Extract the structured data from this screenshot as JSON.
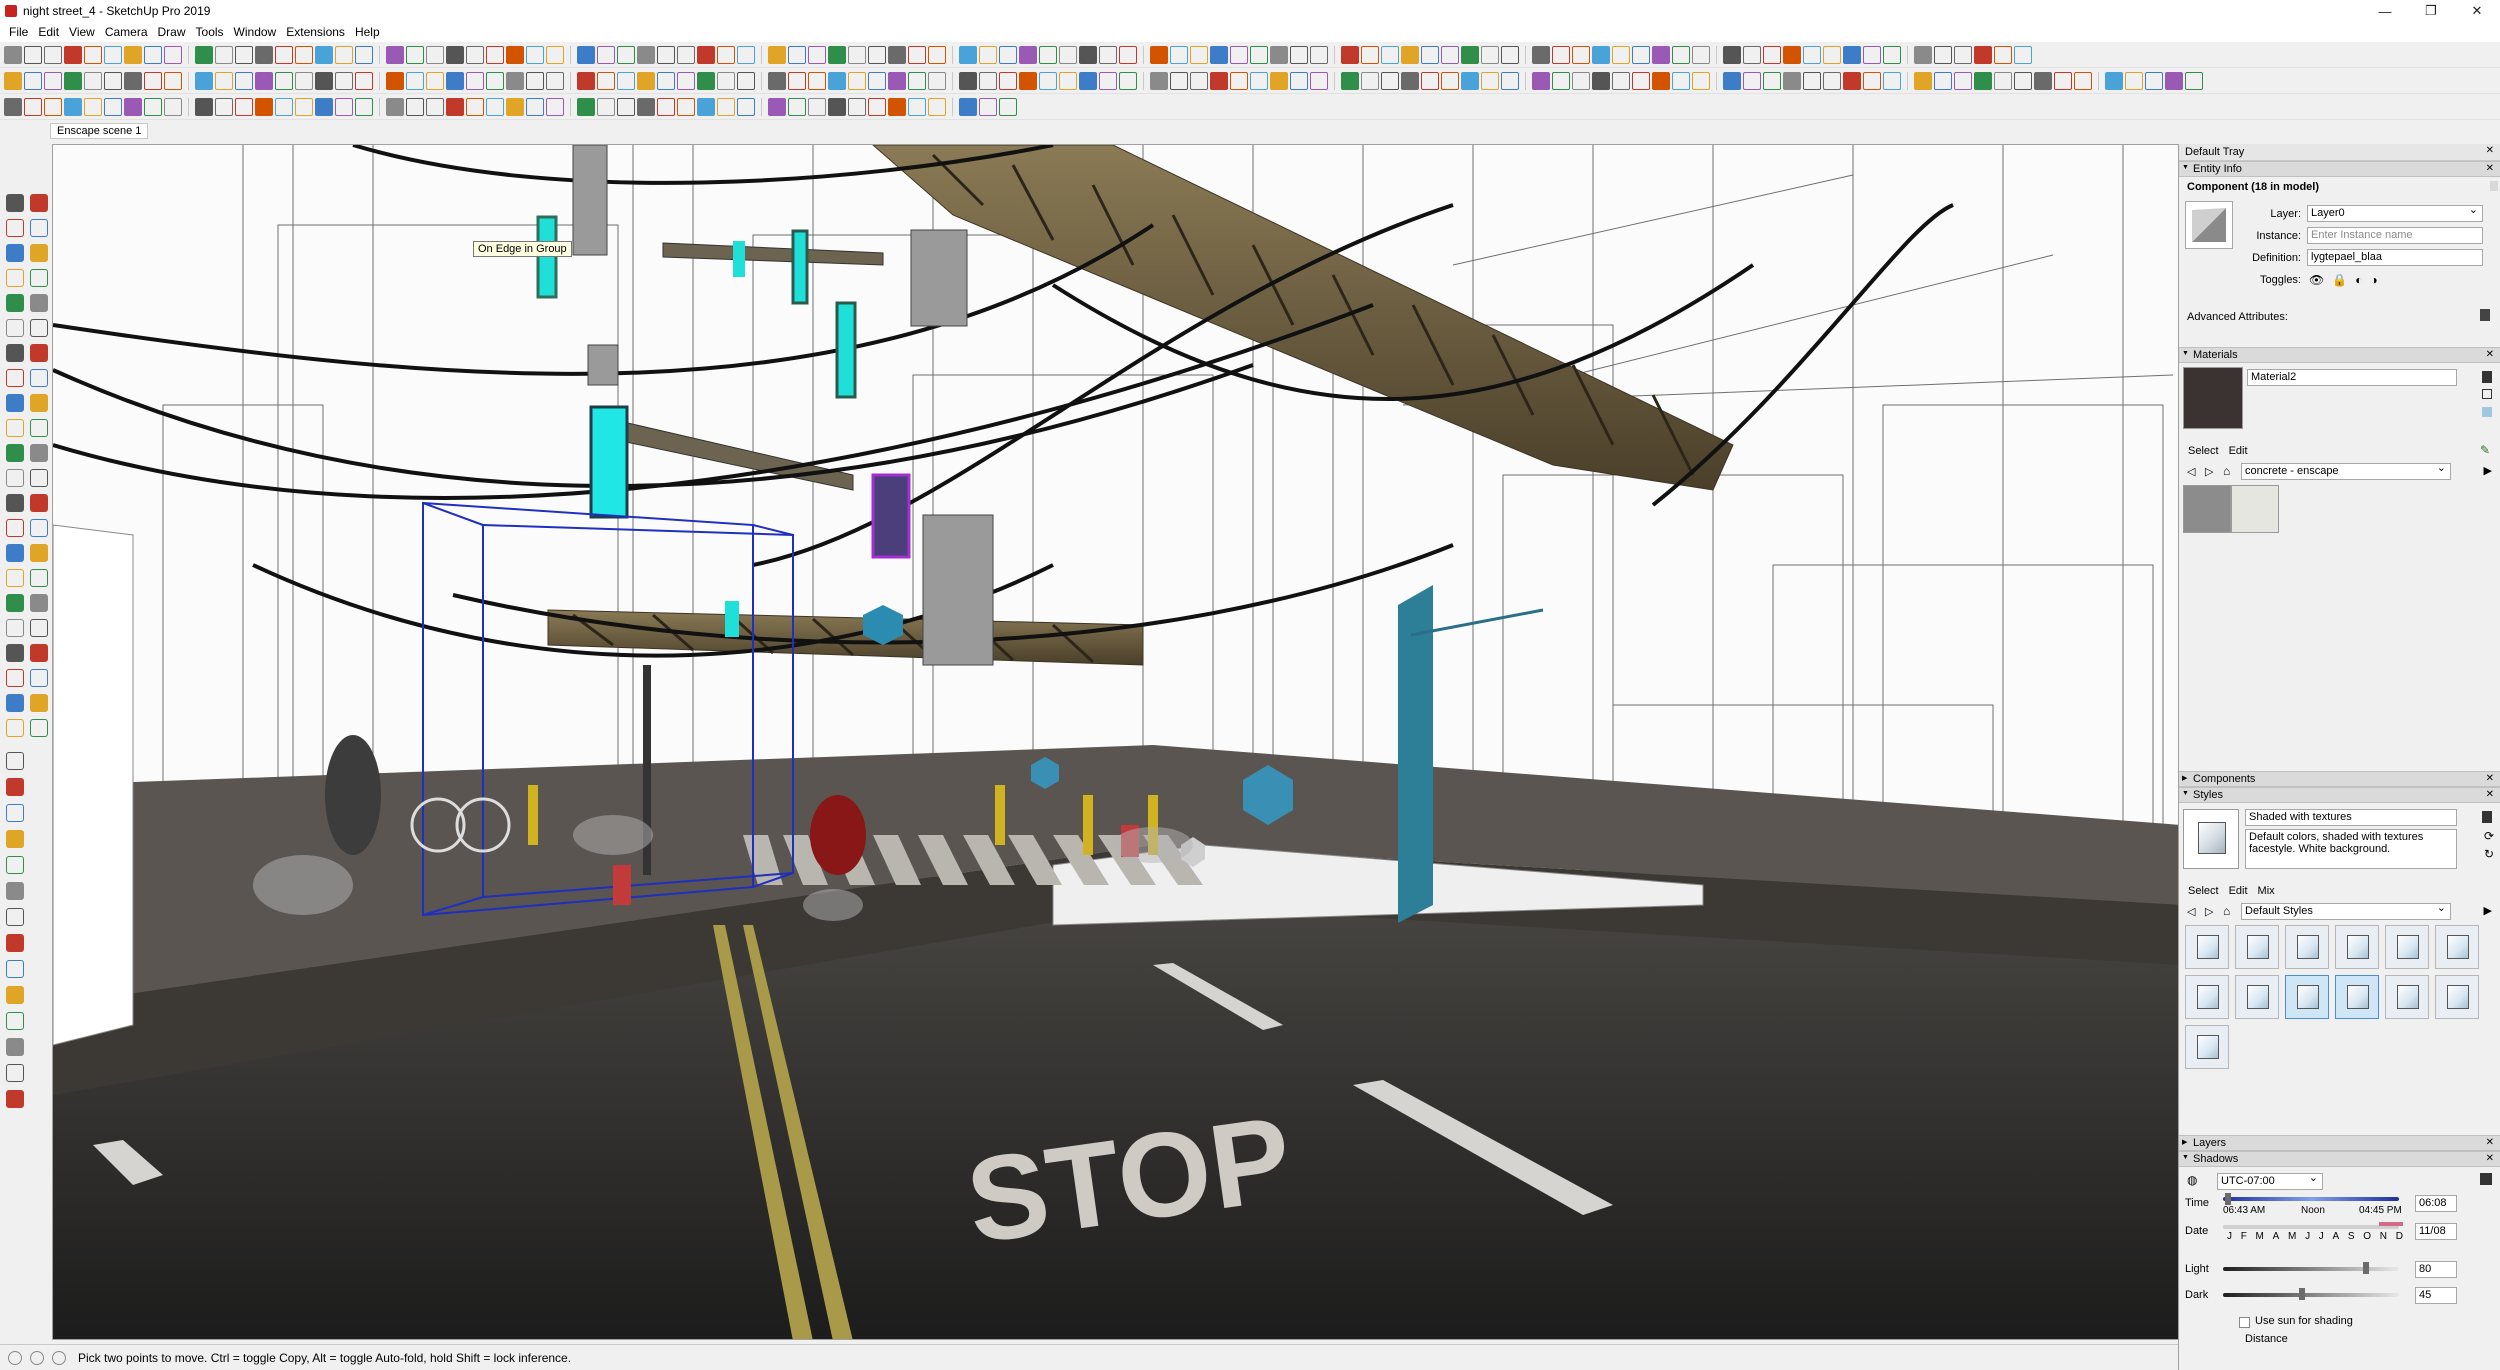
{
  "window": {
    "title": "night street_4 - SketchUp Pro 2019",
    "controls": [
      "—",
      "❐",
      "✕"
    ]
  },
  "menu": [
    "File",
    "Edit",
    "View",
    "Camera",
    "Draw",
    "Tools",
    "Window",
    "Extensions",
    "Help"
  ],
  "scene_tab": "Enscape scene 1",
  "viewport": {
    "tooltip": "On Edge in Group",
    "ground_text": "STOP"
  },
  "status_bar": {
    "hint": "Pick two points to move.  Ctrl = toggle Copy, Alt = toggle Auto-fold, hold Shift = lock inference."
  },
  "tray": {
    "title": "Default Tray",
    "entity_info": {
      "header": "Entity Info",
      "component_title": "Component (18 in model)",
      "layer_label": "Layer:",
      "layer_value": "Layer0",
      "instance_label": "Instance:",
      "instance_placeholder": "Enter Instance name",
      "definition_label": "Definition:",
      "definition_value": "lygtepael_blaa",
      "toggles_label": "Toggles:",
      "advanced": "Advanced Attributes:"
    },
    "materials": {
      "header": "Materials",
      "name": "Material2",
      "tab_select": "Select",
      "tab_edit": "Edit",
      "library": "concrete - enscape"
    },
    "components": {
      "header": "Components"
    },
    "styles": {
      "header": "Styles",
      "name": "Shaded with textures",
      "description": "Default colors, shaded with textures facestyle. White background.",
      "tab_select": "Select",
      "tab_edit": "Edit",
      "tab_mix": "Mix",
      "library": "Default Styles"
    },
    "layers": {
      "header": "Layers"
    },
    "shadows": {
      "header": "Shadows",
      "timezone": "UTC-07:00",
      "time_label": "Time",
      "time_start": "06:43 AM",
      "time_noon": "Noon",
      "time_end": "04:45 PM",
      "time_value": "06:08",
      "date_label": "Date",
      "months": [
        "J",
        "F",
        "M",
        "A",
        "M",
        "J",
        "J",
        "A",
        "S",
        "O",
        "N",
        "D"
      ],
      "date_value": "11/08",
      "light_label": "Light",
      "light_value": "80",
      "dark_label": "Dark",
      "dark_value": "45",
      "use_sun_label": "Use sun for shading",
      "distance_label": "Distance"
    }
  },
  "colors": {
    "chrome": "#f0f0f0",
    "panel_header": "#dadada",
    "selection_blue": "#1f2fbf",
    "neon_cyan": "#1ee0d8",
    "teal_panel": "#2c7f97"
  }
}
